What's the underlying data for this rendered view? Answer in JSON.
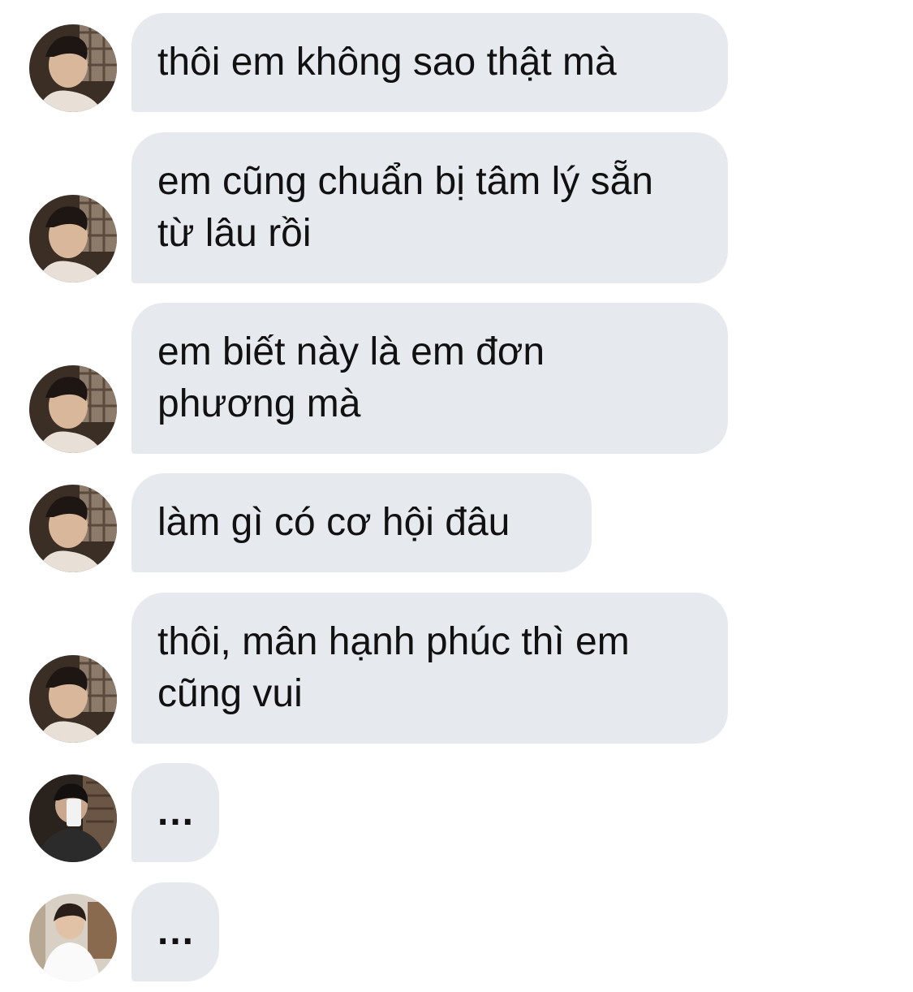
{
  "messages": [
    {
      "sender": "avatar-a",
      "text": "thôi em không sao thật mà"
    },
    {
      "sender": "avatar-a",
      "text": "em cũng chuẩn bị tâm lý sẵn từ lâu rồi"
    },
    {
      "sender": "avatar-a",
      "text": "em biết này là em đơn phương mà"
    },
    {
      "sender": "avatar-a",
      "text": "làm gì có cơ hội đâu"
    },
    {
      "sender": "avatar-a",
      "text": "thôi, mân hạnh phúc thì em cũng vui"
    },
    {
      "sender": "avatar-b",
      "text": "..."
    },
    {
      "sender": "avatar-c",
      "text": "..."
    }
  ],
  "colors": {
    "bubble": "#e6eaef",
    "text": "#111111",
    "background": "#ffffff"
  }
}
